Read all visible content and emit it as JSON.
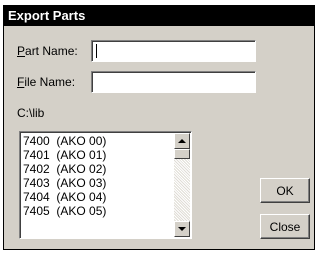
{
  "window": {
    "title": "Export Parts"
  },
  "form": {
    "part_name_label_accel": "P",
    "part_name_label_rest": "art Name:",
    "part_name_value": "",
    "file_name_label_accel": "F",
    "file_name_label_rest": "ile Name:",
    "file_name_value": "",
    "directory": "C:\\lib"
  },
  "list": {
    "items": [
      "7400  (AKO 00)",
      "7401  (AKO 01)",
      "7402  (AKO 02)",
      "7403  (AKO 03)",
      "7404  (AKO 04)",
      "7405  (AKO 05)"
    ]
  },
  "buttons": {
    "ok": "OK",
    "close": "Close"
  }
}
